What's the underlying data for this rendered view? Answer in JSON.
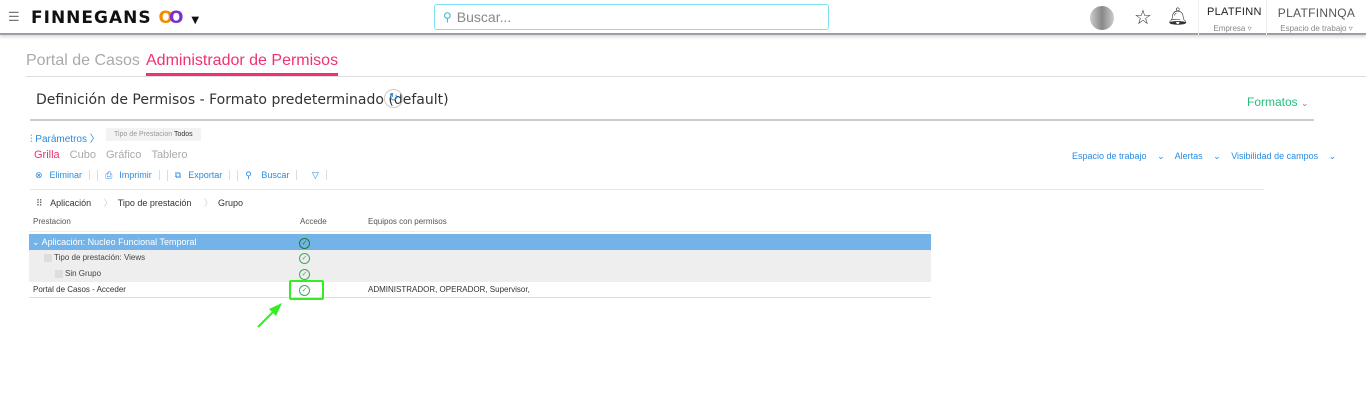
{
  "header": {
    "menu_icon": "hamburger-icon",
    "logo": "FINNEGANS",
    "search_placeholder": "Buscar...",
    "company": {
      "name": "PLATFINN",
      "label": "Empresa"
    },
    "workspace": {
      "name": "PLATFINNQA",
      "label": "Espacio de trabajo"
    }
  },
  "tabs": [
    {
      "label": "Portal de Casos"
    },
    {
      "label": "Administrador de Permisos",
      "active": true
    }
  ],
  "title": "Definición de Permisos - Formato predeterminado (default)",
  "formatos": "Formatos",
  "params": {
    "label": "Parámetros",
    "chip_label": "Tipo de Prestacion",
    "chip_value": "Todos"
  },
  "views": [
    "Grilla",
    "Cubo",
    "Gráfico",
    "Tablero"
  ],
  "toolbar": [
    "Eliminar",
    "Imprimir",
    "Exportar",
    "Buscar"
  ],
  "right_links": [
    "Espacio de trabajo",
    "Alertas",
    "Visibilidad de campos"
  ],
  "breadcrumb": [
    "Aplicación",
    "Tipo de prestación",
    "Grupo"
  ],
  "grid": {
    "columns": [
      "Prestacion",
      "Accede",
      "Equipos con permisos"
    ],
    "rows": [
      {
        "label": "Aplicación: Nucleo Funcional Temporal",
        "equipos": ""
      },
      {
        "label": "Tipo de prestación: Views",
        "equipos": ""
      },
      {
        "label": "Sin Grupo",
        "equipos": ""
      },
      {
        "label": "Portal de Casos - Acceder",
        "equipos": "ADMINISTRADOR, OPERADOR, Supervisor,"
      }
    ]
  },
  "colors": {
    "accent": "#f0326e",
    "link": "#2a8be0",
    "group_row": "#74b3e8",
    "formatos": "#22c07a",
    "highlight": "#33ee22"
  }
}
